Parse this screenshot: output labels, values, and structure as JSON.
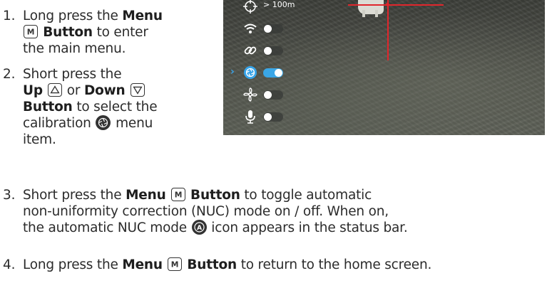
{
  "steps": [
    {
      "number": "1.",
      "lines": [
        {
          "a": "Long press the ",
          "b": "Menu"
        },
        {
          "key": "M",
          "b": " Button",
          "a": " to enter"
        },
        {
          "a": "the main menu."
        }
      ]
    },
    {
      "number": "2.",
      "lines": [
        {
          "a": "Short press the"
        },
        {
          "b1": "Up ",
          "key1": "up",
          "a1": " or ",
          "b2": "Down ",
          "key2": "down"
        },
        {
          "b": "Button",
          "a": " to select the"
        },
        {
          "a1": "calibration ",
          "icon": "calibration",
          "a2": " menu"
        },
        {
          "a": "item."
        }
      ]
    },
    {
      "number": "3.",
      "lines": [
        {
          "a1": "Short press the ",
          "b": "Menu ",
          "key": "M",
          "b2": " Button",
          "a2": " to toggle automatic"
        },
        {
          "a": "non-uniformity correction (NUC) mode on / off. When on,"
        },
        {
          "a1": "the automatic NUC mode ",
          "icon": "A",
          "a2": " icon appears in the status bar."
        }
      ]
    },
    {
      "number": "4.",
      "lines": [
        {
          "a1": "Long press the ",
          "b": "Menu ",
          "key": "M",
          "b2": " Button",
          "a2": " to return to the home screen."
        }
      ]
    }
  ],
  "screen": {
    "distance_label": "> 100m",
    "menu_items": [
      {
        "icon": "rangefinder-icon",
        "type": "label"
      },
      {
        "icon": "wifi-icon",
        "toggle_on": false
      },
      {
        "icon": "link-icon",
        "toggle_on": false
      },
      {
        "icon": "calibration-icon",
        "toggle_on": true,
        "selected": true
      },
      {
        "icon": "fan-icon",
        "toggle_on": false
      },
      {
        "icon": "microphone-icon",
        "toggle_on": false
      }
    ],
    "colors": {
      "accent": "#36a4ea",
      "crosshair": "#e0262c"
    }
  }
}
